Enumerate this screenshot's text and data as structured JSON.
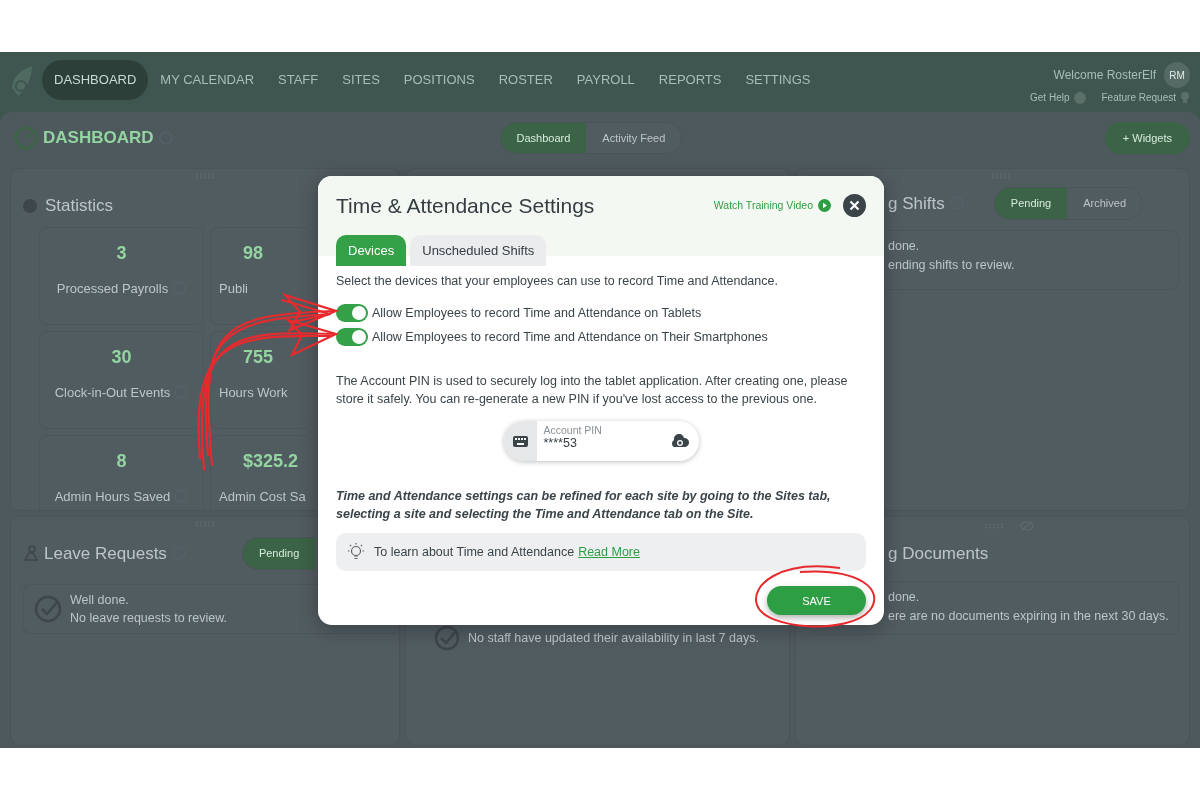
{
  "nav": {
    "items": [
      {
        "label": "DASHBOARD",
        "selected": true
      },
      {
        "label": "MY CALENDAR",
        "selected": false
      },
      {
        "label": "STAFF",
        "selected": false
      },
      {
        "label": "SITES",
        "selected": false
      },
      {
        "label": "POSITIONS",
        "selected": false
      },
      {
        "label": "ROSTER",
        "selected": false
      },
      {
        "label": "PAYROLL",
        "selected": false
      },
      {
        "label": "REPORTS",
        "selected": false
      },
      {
        "label": "SETTINGS",
        "selected": false
      }
    ],
    "welcome": "Welcome RosterElf",
    "avatar": "RM",
    "help_link": "Get Help",
    "feature_link": "Feature Request"
  },
  "header": {
    "title": "DASHBOARD",
    "views": [
      {
        "label": "Dashboard",
        "selected": true
      },
      {
        "label": "Activity Feed",
        "selected": false
      }
    ],
    "add_button": "+ Widgets"
  },
  "statistics": {
    "title": "Statistics",
    "stats": [
      {
        "value": "3",
        "label": "Processed Payrolls",
        "help": true
      },
      {
        "value": "98",
        "label": "Publi",
        "help": false
      },
      {
        "value": "30",
        "label": "Clock-in-Out Events",
        "help": true
      },
      {
        "value": "755",
        "label": "Hours Work",
        "help": false
      },
      {
        "value": "8",
        "label": "Admin Hours Saved",
        "help": true
      },
      {
        "value": "$325.2",
        "label": "Admin Cost Sa",
        "help": false
      }
    ]
  },
  "shifts_panel": {
    "title": "g Shifts",
    "filters": [
      {
        "label": "Pending",
        "selected": true
      },
      {
        "label": "Archived",
        "selected": false
      }
    ],
    "lines": [
      "done.",
      "ending shifts to review."
    ]
  },
  "leave_panel": {
    "title": "Leave Requests",
    "filters": [
      {
        "label": "Pending",
        "selected": true
      }
    ],
    "lines": [
      "Well done.",
      "No leave requests to review."
    ]
  },
  "availability_panel": {
    "lines": [
      "No staff have updated their availability in last 7 days."
    ]
  },
  "documents_panel": {
    "title": "g Documents",
    "lines": [
      "done.",
      "ere are no documents expiring in the next 30 days."
    ]
  },
  "modal": {
    "title": "Time & Attendance Settings",
    "video_link": "Watch Training Video",
    "tabs": [
      {
        "label": "Devices",
        "selected": true
      },
      {
        "label": "Unscheduled Shifts",
        "selected": false
      }
    ],
    "intro": "Select the devices that your employees can use to record Time and Attendance.",
    "switches": [
      {
        "label": "Allow Employees to record Time and Attendance on Tablets",
        "on": true
      },
      {
        "label": "Allow Employees to record Time and Attendance on Their Smartphones",
        "on": true
      }
    ],
    "pin_info": "The Account PIN is used to securely log into the tablet application. After creating one, please store it safely. You can re-generate a new PIN if you've lost access to the previous one.",
    "pin_field": {
      "label": "Account PIN",
      "value": "****53"
    },
    "note": "Time and Attendance settings can be refined for each site by going to the Sites tab, selecting a site and selecting the Time and Attendance tab on the Site.",
    "tip": {
      "text": "To learn about Time and Attendance",
      "link": "Read More"
    },
    "save_button": "SAVE"
  }
}
